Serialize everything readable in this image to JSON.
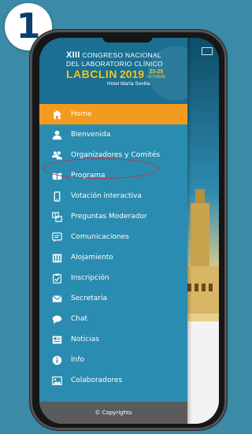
{
  "step_badge": {
    "number": "1"
  },
  "event": {
    "line1_prefix": "XIII",
    "line1_rest": " CONGRESO NACIONAL",
    "line2": "DEL LABORATORIO CLÍNICO",
    "name": "LABCLIN",
    "year": "2019",
    "dates_top": "23-25",
    "dates_bottom": "OCTUBRE",
    "venue": "Hotel María Sevilla"
  },
  "menu": {
    "items": [
      {
        "label": "Home",
        "icon": "home-icon",
        "active": true
      },
      {
        "label": "Bienvenida",
        "icon": "person-icon"
      },
      {
        "label": "Organizadores y Comités",
        "icon": "people-icon"
      },
      {
        "label": "Programa",
        "icon": "book-icon"
      },
      {
        "label": "Votación interactiva",
        "icon": "mobile-icon"
      },
      {
        "label": "Preguntas Moderador",
        "icon": "question-icon"
      },
      {
        "label": "Comunicaciones",
        "icon": "comments-icon"
      },
      {
        "label": "Alojamiento",
        "icon": "building-icon"
      },
      {
        "label": "Inscripción",
        "icon": "checklist-icon"
      },
      {
        "label": "Secretaría",
        "icon": "envelope-icon"
      },
      {
        "label": "Chat",
        "icon": "chat-icon"
      },
      {
        "label": "Noticias",
        "icon": "newspaper-icon"
      },
      {
        "label": "Info",
        "icon": "info-icon"
      },
      {
        "label": "Colaboradores",
        "icon": "image-icon"
      }
    ]
  },
  "footer": {
    "copyright": "© Copyrights"
  },
  "colors": {
    "drawer": "#2a8cb0",
    "active_item": "#f39b1f",
    "highlight_ring": "#b23a4f",
    "brand_yellow": "#f5c518",
    "page_background": "#3b8aa6"
  }
}
